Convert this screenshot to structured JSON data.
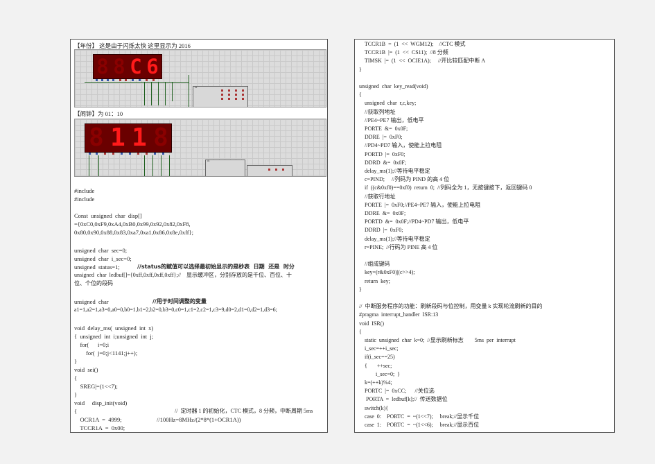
{
  "left_page": {
    "caption_1": "【年份】   这是由于闪烁太快   这里显示为 2016",
    "display_1": {
      "digits": [
        "C",
        "6"
      ],
      "unlit": "8"
    },
    "chip_1_label": "U1",
    "caption_2": "【闹钟】为 01：10",
    "display_2": {
      "digits": [
        "1",
        "1"
      ],
      "unlit": "8"
    },
    "chip_2_label": "U1",
    "lines": [
      "#include",
      "#include",
      "",
      "Const  unsigned  char  disp[]",
      "={0xC0,0xF9,0xA4,0xB0,0x99,0x92,0x82,0xF8,",
      "0x80,0x90,0x88,0x83,0xa7,0xa1,0x86,0x8e,0xff};",
      "",
      "unsigned  char  sec=0;",
      "unsigned  char  i_sec=0;",
      "unsigned  status=1;",
      "unsigned  char  ledbuf[]={0xff,0xff,0xff,0xff};//    显示缓冲区，分别存放的是千位、百位、十",
      "位、个位的段码",
      "",
      "unsigned  char",
      "a1=1,a2=1,a3=0,a0=0,b0=1,b1=2,b2=0,b3=0,c0=1,c1=2,c2=1,c3=9,d0=2,d1=0,d2=1,d3=6;",
      "",
      "void  delay_ms(  unsigned  int  x)",
      "{  unsigned  int  i;unsigned  int  j;",
      "    for(      i=0;i",
      "        for(  j=0;j<1141;j++);",
      "}",
      "void  sei()",
      "{",
      "    SREG|=(1<<7);",
      "}",
      "void     disp_init(void)",
      "{",
      "    OCR1A  =  4999;",
      "    TCCR1A  =  0x00;"
    ],
    "comment_status": "//status的赋值可以选择最初始显示的是秒表  日期  还是  时分",
    "comment_vars": "//用于时间调整的变量",
    "comment_timer": "//  定时器 1 的初始化，CTC 模式，8 分频，中断周期 5ms",
    "comment_ocr": "//100Hz=8MHz/(2*8*(1+OCR1A))"
  },
  "right_page": {
    "lines": [
      "    TCCR1B  =  (1  <<  WGM12);    //CTC 模式",
      "    TCCR1B  |=  (1  <<  CS11);  //8 分频",
      "    TIMSK  |=  (1  <<  OCIE1A);     //开比较匹配中断 A",
      "}",
      "",
      "unsigned  char  key_read(void)",
      "{",
      "    unsigned  char  r,c,key;",
      "    //获取列地址",
      "    //PE4~PE7 输出，低电平",
      "    PORTE  &=  0x0F;",
      "    DDRE  |=  0xF0;",
      "    //PD4~PD7 输入，使能上拉电阻",
      "    PORTD  |=  0xF0;",
      "    DDRD  &=  0x0F;",
      "    delay_ms(1);//等待电平稳定",
      "    c=PIND;     //列码为 PIND 的高 4 位",
      "    if  ((c&0xf0)==0xf0)  return  0;  //列码全为 1，无按键按下，返回键码 0",
      "    //获取行地址",
      "    PORTE  |=  0xF0;//PE4~PE7 输入，使能上拉电阻",
      "    DDRE  &=  0x0F;",
      "    PORTD  &=  0x0F;//PD4~PD7 输出，低电平",
      "    DDRD  |=  0xF0;",
      "    delay_ms(1);//等待电平稳定",
      "    r=PINE;  //行码为 PINE 高 4 位",
      "",
      "    //组成键码",
      "    key=(r&0xF0)|(c>>4);",
      "    return  key;",
      "}",
      "",
      "//  中断服务程序的功能：刷新段码与位控制，用变量 k 实现轮流刷新的目的",
      "#pragma  interrupt_handler  ISR:13",
      "void  ISR()",
      "{",
      "    static  unsigned  char  k=0;  //显示刷新标志        5ms  per  interrupt",
      "    i_sec=++i_sec;",
      "    if(i_sec==25)",
      "    {       ++sec;",
      "            i_sec=0;  }",
      "    k=(++k)%4;",
      "    PORTC  |=  0xCC;      //关位选",
      "     PORTA  =  ledbuf[k];//  传送数据位",
      "    switch(k){",
      "    case  0:    PORTC  =  ~(1<<7);     break;//显示千位",
      "    case  1:    PORTC  =  ~(1<<6);     break;//显示百位"
    ]
  }
}
